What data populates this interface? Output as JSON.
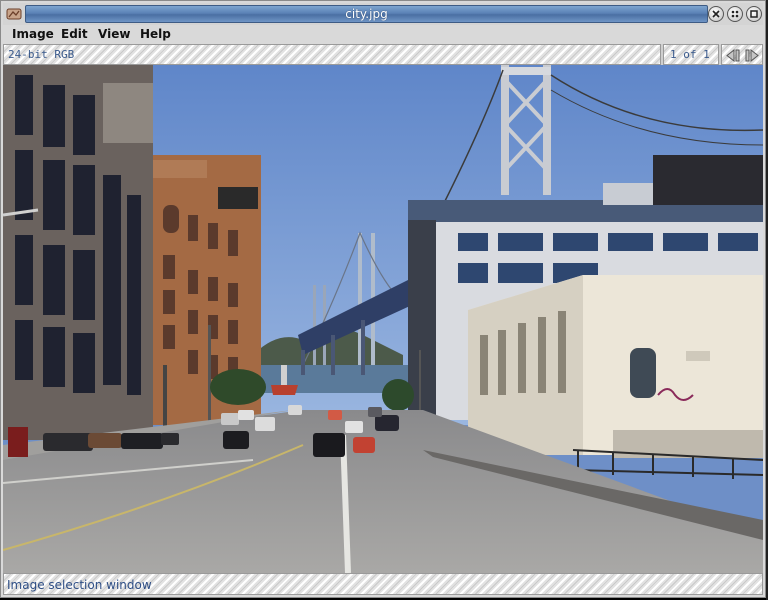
{
  "window": {
    "title": "city.jpg"
  },
  "menu": {
    "items": [
      "Image",
      "Edit",
      "View",
      "Help"
    ]
  },
  "info": {
    "format": "24-bit RGB",
    "page": "1 of 1"
  },
  "status": {
    "text": "Image selection window"
  },
  "icons": {
    "app": "viewer-app-icon",
    "close": "close-icon",
    "maximize": "maximize-icon",
    "iconify": "iconify-icon",
    "prev": "prev-page-icon",
    "next": "next-page-icon"
  },
  "colors": {
    "title_accent": "#5b82b6",
    "info_text": "#3a5a8c",
    "status_text": "#2f4f86"
  }
}
